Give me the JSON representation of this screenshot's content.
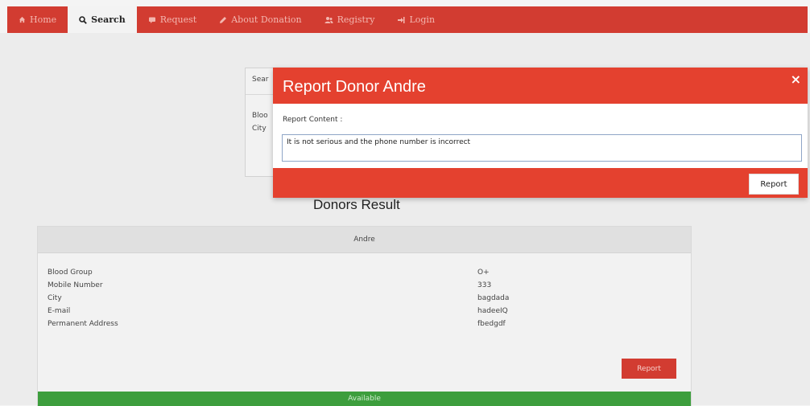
{
  "nav": {
    "items": [
      {
        "label": "Home",
        "icon": "home-icon"
      },
      {
        "label": "Search",
        "icon": "search-icon"
      },
      {
        "label": "Request",
        "icon": "comment-icon"
      },
      {
        "label": "About Donation",
        "icon": "pencil-icon"
      },
      {
        "label": "Registry",
        "icon": "users-icon"
      },
      {
        "label": "Login",
        "icon": "sign-in-icon"
      }
    ],
    "active": "Search"
  },
  "search_panel": {
    "header": "Sear",
    "line1": "Bloo",
    "line2": "City"
  },
  "modal": {
    "title": "Report Donor Andre",
    "close_symbol": "×",
    "label": "Report Content :",
    "textarea_value": "It is not serious and the phone number is incorrect",
    "submit_label": "Report"
  },
  "result": {
    "heading": "Donors Result",
    "donor": {
      "name": "Andre",
      "fields": [
        {
          "label": "Blood Group",
          "value": "O+"
        },
        {
          "label": "Mobile Number",
          "value": "333"
        },
        {
          "label": "City",
          "value": "bagdada"
        },
        {
          "label": "E-mail",
          "value": "hadeeIQ"
        },
        {
          "label": "Permanent Address",
          "value": "fbedgdf"
        }
      ],
      "report_label": "Report",
      "status": "Available"
    }
  },
  "colors": {
    "navbar": "#d23c31",
    "modal": "#e4412f",
    "available": "#3d9e3d"
  }
}
